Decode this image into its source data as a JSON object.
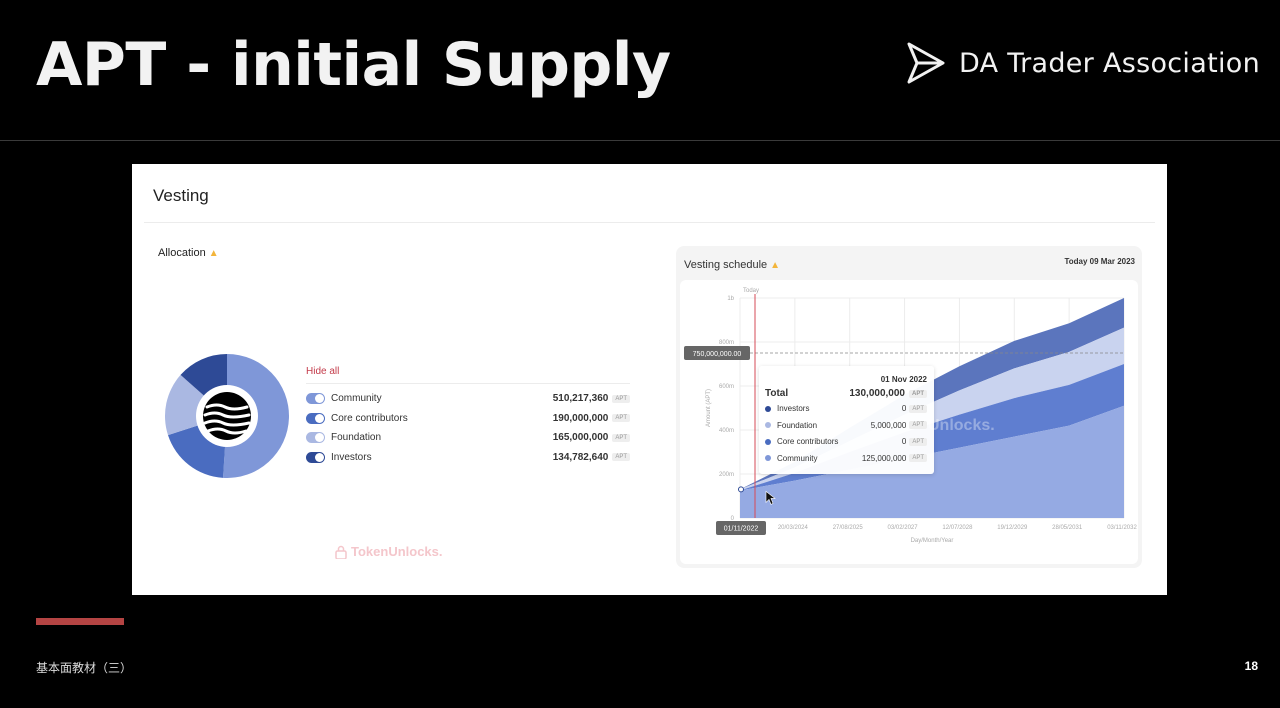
{
  "slide": {
    "title": "APT - initial Supply",
    "brand": "DA Trader Association",
    "footer_left": "基本面教材（三）",
    "page_number": "18"
  },
  "panel": {
    "title": "Vesting",
    "allocation_title": "Allocation",
    "hide_all": "Hide all",
    "watermark": "TokenUnlocks.",
    "items": [
      {
        "label": "Community",
        "value": "510,217,360",
        "unit": "APT",
        "color": "#7f97d8",
        "enabled": true
      },
      {
        "label": "Core contributors",
        "value": "190,000,000",
        "unit": "APT",
        "color": "#4a6cc0",
        "enabled": true
      },
      {
        "label": "Foundation",
        "value": "165,000,000",
        "unit": "APT",
        "color": "#aab8e2",
        "enabled": true
      },
      {
        "label": "Investors",
        "value": "134,782,640",
        "unit": "APT",
        "color": "#2e4a96",
        "enabled": true
      }
    ]
  },
  "vesting": {
    "title": "Vesting schedule",
    "today": "Today 09 Mar 2023",
    "today_marker": "Today",
    "y_axis_label": "Amount (APT)",
    "x_axis_label": "Day/Month/Year",
    "y_ticks": [
      "1b",
      "800m",
      "600m",
      "400m",
      "200m",
      "0"
    ],
    "x_ticks": [
      "01/11/2022",
      "20/03/2024",
      "27/08/2025",
      "03/02/2027",
      "12/07/2028",
      "19/12/2029",
      "28/05/2031",
      "03/11/2032"
    ],
    "crosshair_label": "750,000,000.00",
    "tooltip": {
      "date": "01 Nov 2022",
      "total_label": "Total",
      "total_value": "130,000,000",
      "unit": "APT",
      "rows": [
        {
          "label": "Investors",
          "value": "0",
          "color": "#2e4a96"
        },
        {
          "label": "Foundation",
          "value": "5,000,000",
          "color": "#aab8e2"
        },
        {
          "label": "Core contributors",
          "value": "0",
          "color": "#4a6cc0"
        },
        {
          "label": "Community",
          "value": "125,000,000",
          "color": "#7f97d8"
        }
      ]
    },
    "watermark": "Unlocks."
  },
  "chart_data": {
    "type": "area",
    "title": "Vesting schedule",
    "xlabel": "Day/Month/Year",
    "ylabel": "Amount (APT)",
    "x": [
      "01/11/2022",
      "20/03/2024",
      "27/08/2025",
      "03/02/2027",
      "12/07/2028",
      "19/12/2029",
      "28/05/2031",
      "03/11/2032"
    ],
    "ylim": [
      0,
      1000000000
    ],
    "stacked": true,
    "series": [
      {
        "name": "Community",
        "values": [
          125000000,
          170000000,
          220000000,
          270000000,
          320000000,
          370000000,
          420000000,
          510217360
        ]
      },
      {
        "name": "Core contributors",
        "values": [
          0,
          35000000,
          80000000,
          120000000,
          150000000,
          175000000,
          185000000,
          190000000
        ]
      },
      {
        "name": "Foundation",
        "values": [
          5000000,
          25000000,
          50000000,
          80000000,
          110000000,
          135000000,
          150000000,
          165000000
        ]
      },
      {
        "name": "Investors",
        "values": [
          0,
          25000000,
          60000000,
          90000000,
          110000000,
          125000000,
          130000000,
          134782640
        ]
      }
    ],
    "grid": true,
    "legend": "tooltip"
  }
}
